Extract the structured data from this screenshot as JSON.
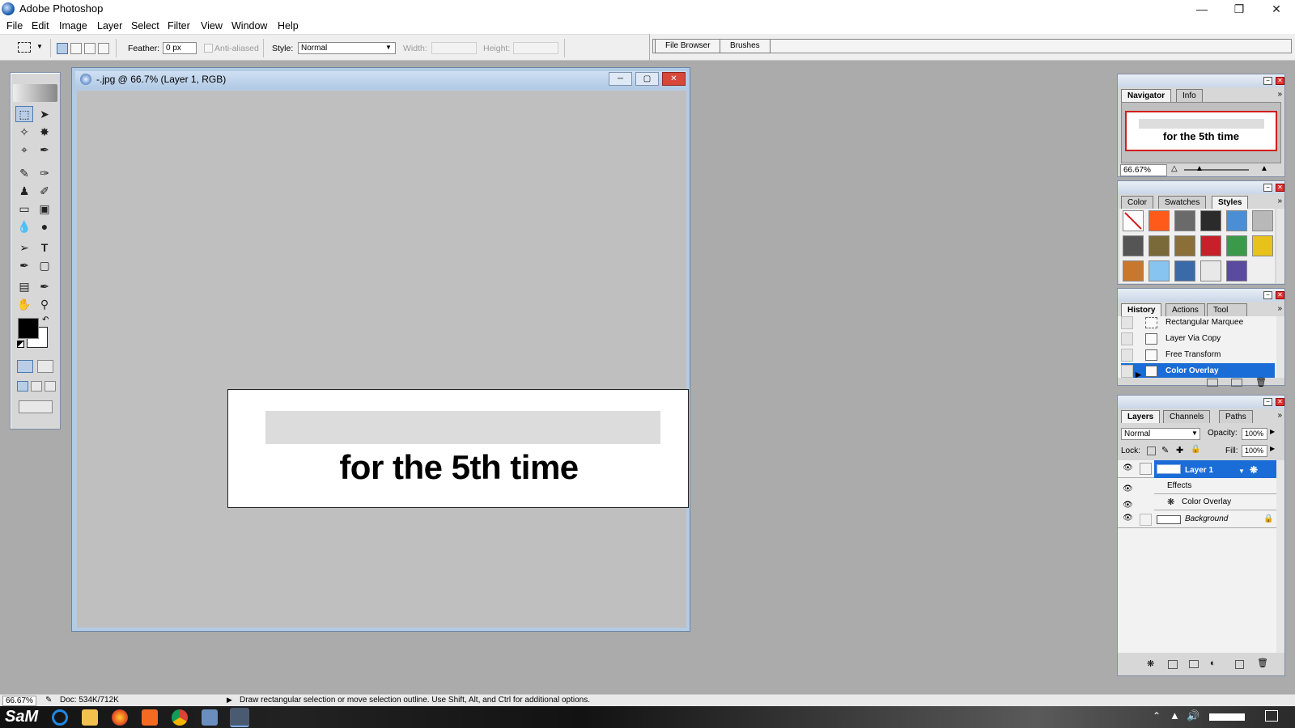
{
  "window": {
    "title": "Adobe Photoshop",
    "controls": [
      "—",
      "❐",
      "✕"
    ]
  },
  "menu": [
    "File",
    "Edit",
    "Image",
    "Layer",
    "Select",
    "Filter",
    "View",
    "Window",
    "Help"
  ],
  "options_bar": {
    "feather_label": "Feather:",
    "feather_value": "0 px",
    "anti_aliased": "Anti-aliased",
    "style_label": "Style:",
    "style_value": "Normal",
    "width_label": "Width:",
    "height_label": "Height:"
  },
  "palette_well": {
    "tabs": [
      "File Browser",
      "Brushes"
    ]
  },
  "document": {
    "title": "-.jpg @ 66.7% (Layer 1, RGB)",
    "canvas_text": "for the 5th time"
  },
  "navigator": {
    "tabs": [
      "Navigator",
      "Info"
    ],
    "preview_text": "for the 5th time",
    "zoom": "66.67%"
  },
  "styles_panel": {
    "tabs": [
      "Color",
      "Swatches",
      "Styles"
    ],
    "swatch_colors": [
      "#ffffff",
      "#ff5a1a",
      "#6a6a6a",
      "#2b2b2b",
      "#4a8fd6",
      "#b8b8b8",
      "#555555",
      "#7a6a3a",
      "#8a7038",
      "#c8202a",
      "#3a9a4a",
      "#e8c21a",
      "#c8782e",
      "#88c4f0",
      "#3a6aa8",
      "#e8e8e8",
      "#5a4aa0"
    ]
  },
  "history_panel": {
    "tabs": [
      "History",
      "Actions",
      "Tool Presets"
    ],
    "items": [
      "Rectangular Marquee",
      "Layer Via Copy",
      "Free Transform",
      "Color Overlay"
    ],
    "selected_index": 3
  },
  "layers_panel": {
    "tabs": [
      "Layers",
      "Channels",
      "Paths"
    ],
    "blend_mode": "Normal",
    "opacity_label": "Opacity:",
    "opacity": "100%",
    "lock_label": "Lock:",
    "fill_label": "Fill:",
    "fill": "100%",
    "layers": [
      {
        "name": "Layer 1",
        "selected": true
      },
      {
        "name": "Effects"
      },
      {
        "name": "Color Overlay"
      },
      {
        "name": "Background"
      }
    ]
  },
  "status_bar": {
    "zoom": "66.67%",
    "doc": "Doc: 534K/712K",
    "hint": "Draw rectangular selection or move selection outline.  Use Shift, Alt, and Ctrl for additional options."
  },
  "taskbar": {
    "logo": "SaM"
  },
  "colors": {
    "accent": "#1a6cd6",
    "selection": "#1a6cd6",
    "frame": "#b3cbe5"
  }
}
